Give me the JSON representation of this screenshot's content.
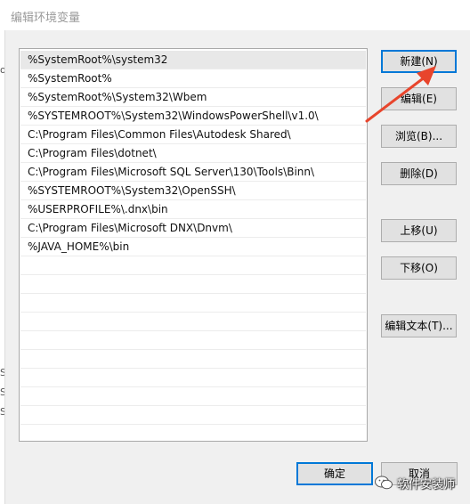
{
  "window": {
    "title": "编辑环境变量"
  },
  "path_list": {
    "items": [
      "%SystemRoot%\\system32",
      "%SystemRoot%",
      "%SystemRoot%\\System32\\Wbem",
      "%SYSTEMROOT%\\System32\\WindowsPowerShell\\v1.0\\",
      "C:\\Program Files\\Common Files\\Autodesk Shared\\",
      "C:\\Program Files\\dotnet\\",
      "C:\\Program Files\\Microsoft SQL Server\\130\\Tools\\Binn\\",
      "%SYSTEMROOT%\\System32\\OpenSSH\\",
      "%USERPROFILE%\\.dnx\\bin",
      "C:\\Program Files\\Microsoft DNX\\Dnvm\\",
      "%JAVA_HOME%\\bin"
    ],
    "selected_index": 0
  },
  "buttons": {
    "new": "新建(N)",
    "edit": "编辑(E)",
    "browse": "浏览(B)...",
    "delete": "删除(D)",
    "move_up": "上移(U)",
    "move_down": "下移(O)",
    "edit_text": "编辑文本(T)...",
    "ok": "确定",
    "cancel": "取消"
  },
  "background_fragments": {
    "left_glyphs": [
      "o",
      "S",
      "S",
      "S"
    ]
  },
  "watermark": {
    "text": "软件安装师"
  },
  "colors": {
    "arrow": "#e8452c",
    "accent": "#0078d7"
  }
}
